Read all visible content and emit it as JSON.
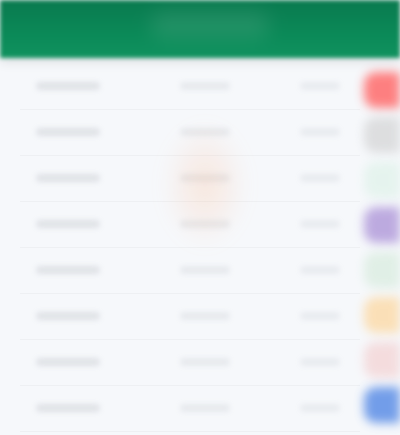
{
  "header": {
    "title": ""
  },
  "rows": [
    {
      "primary": "",
      "mid": "",
      "right": ""
    },
    {
      "primary": "",
      "mid": "",
      "right": ""
    },
    {
      "primary": "",
      "mid": "",
      "right": ""
    },
    {
      "primary": "",
      "mid": "",
      "right": ""
    },
    {
      "primary": "",
      "mid": "",
      "right": ""
    },
    {
      "primary": "",
      "mid": "",
      "right": ""
    },
    {
      "primary": "",
      "mid": "",
      "right": ""
    },
    {
      "primary": "",
      "mid": "",
      "right": ""
    }
  ],
  "side_tabs": [
    {
      "color": "#ff6b6b"
    },
    {
      "color": "#c9c9c9"
    },
    {
      "color": "#d8f0e4"
    },
    {
      "color": "#b39ddb"
    },
    {
      "color": "#cfe8d5"
    },
    {
      "color": "#ffcc80"
    },
    {
      "color": "#f3c6c6"
    },
    {
      "color": "#5c8ee6"
    }
  ]
}
